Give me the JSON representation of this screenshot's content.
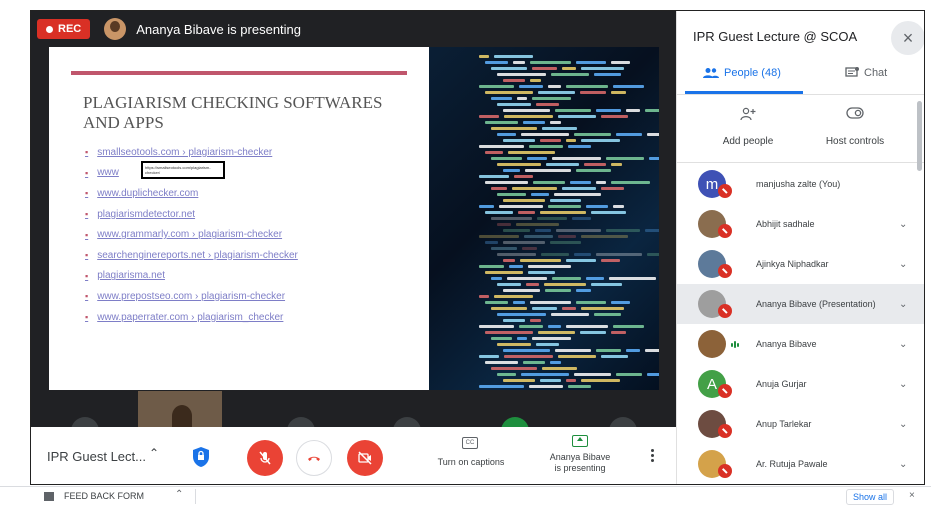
{
  "top_bar": {
    "rec_label": "REC",
    "presenter_text": "Ananya Bibave is presenting"
  },
  "slide": {
    "title": "PLAGIARISM CHECKING SOFTWARES AND APPS",
    "links": [
      "smallseotools.com › plagiarism-checker",
      "www",
      "www.duplichecker.com",
      "plagiarismdetector.net",
      "www.grammarly.com › plagiarism-checker",
      "searchenginereports.net › plagiarism-checker",
      "plagiarisma.net",
      "www.prepostseo.com › plagiarism-checker",
      "www.paperrater.com › plagiarism_checker"
    ],
    "tooltip_text": "https://smallseotools.com/plagiarism-checker/"
  },
  "controls": {
    "meeting_name": "IPR Guest Lect...",
    "captions_label": "Turn on captions",
    "captions_icon_text": "CC",
    "presenting_label_line1": "Ananya Bibave",
    "presenting_label_line2": "is presenting"
  },
  "panel": {
    "title": "IPR Guest Lecture @ SCOA",
    "tab_people": "People (48)",
    "tab_chat": "Chat",
    "add_people": "Add people",
    "host_controls": "Host controls",
    "participants": [
      {
        "name": "manjusha zalte (You)",
        "initial": "m",
        "color": "#3f51b5",
        "muted": true,
        "highlight": false,
        "chevron": false
      },
      {
        "name": "Abhijit sadhale",
        "initial": "",
        "color": "#8a6d4f",
        "muted": true,
        "highlight": false,
        "chevron": true
      },
      {
        "name": "Ajinkya Niphadkar",
        "initial": "",
        "color": "#5d7a9a",
        "muted": true,
        "highlight": false,
        "chevron": true
      },
      {
        "name": "Ananya Bibave (Presentation)",
        "initial": "",
        "color": "#9e9e9e",
        "muted": true,
        "highlight": true,
        "chevron": true
      },
      {
        "name": "Ananya Bibave",
        "initial": "",
        "color": "#8c6239",
        "muted": false,
        "highlight": false,
        "chevron": true
      },
      {
        "name": "Anuja Gurjar",
        "initial": "A",
        "color": "#43a047",
        "muted": true,
        "highlight": false,
        "chevron": true
      },
      {
        "name": "Anup Tarlekar",
        "initial": "",
        "color": "#6d4c41",
        "muted": true,
        "highlight": false,
        "chevron": true
      },
      {
        "name": "Ar. Rutuja Pawale",
        "initial": "",
        "color": "#d4a24a",
        "muted": true,
        "highlight": false,
        "chevron": true
      }
    ]
  },
  "download_bar": {
    "file_name": "FEED BACK FORM",
    "show_all": "Show all"
  },
  "colors": {
    "rec_red": "#d93025",
    "accent_blue": "#1a73e8",
    "end_call_red": "#ea4335",
    "slide_accent": "#c0566c"
  }
}
